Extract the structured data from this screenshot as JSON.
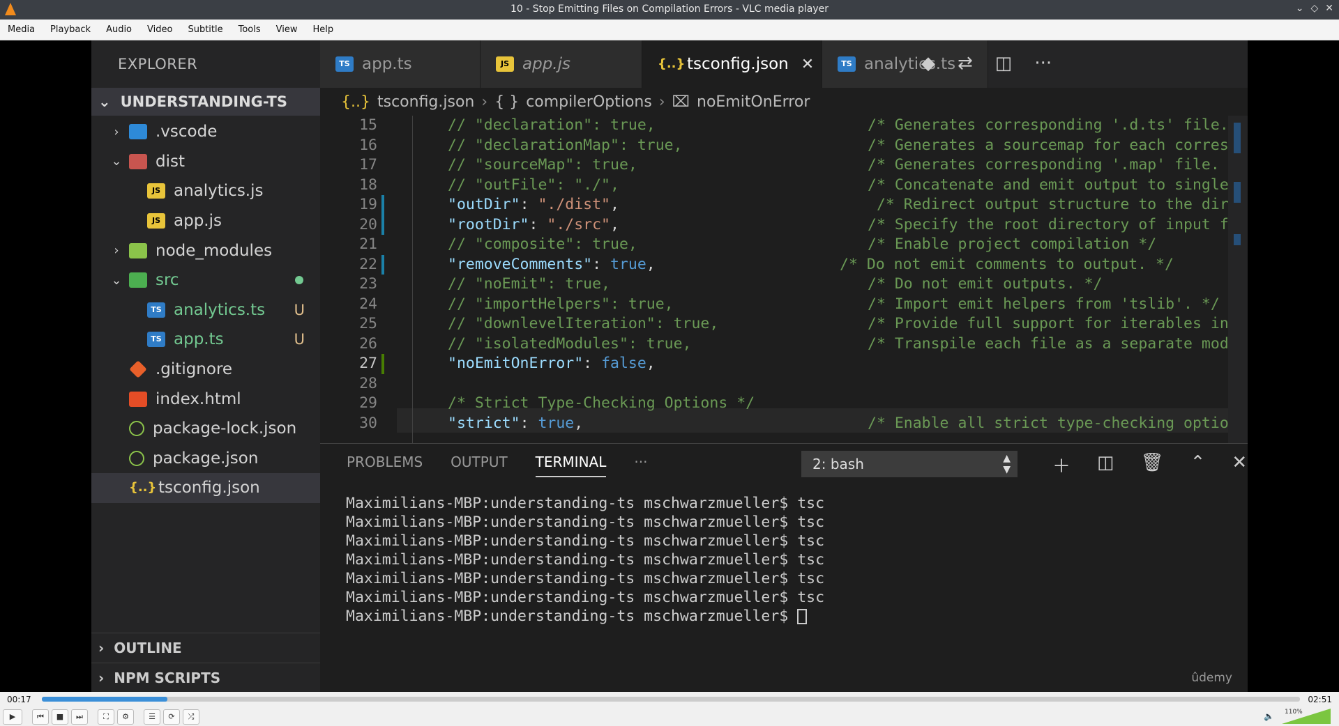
{
  "window": {
    "title": "10 - Stop Emitting Files on Compilation Errors - VLC media player"
  },
  "menu": [
    "Media",
    "Playback",
    "Audio",
    "Video",
    "Subtitle",
    "Tools",
    "View",
    "Help"
  ],
  "sidebar": {
    "header": "EXPLORER",
    "root": "UNDERSTANDING-TS",
    "items": [
      {
        "label": ".vscode",
        "icon": "vscode-folder-icon",
        "kind": "vsc",
        "indent": 1,
        "chev": "›",
        "badge": ""
      },
      {
        "label": "dist",
        "icon": "folder-icon",
        "kind": "fold",
        "indent": 1,
        "chev": "⌄",
        "badge": ""
      },
      {
        "label": "analytics.js",
        "icon": "js-file-icon",
        "kind": "js",
        "indent": 2,
        "chev": "",
        "badge": ""
      },
      {
        "label": "app.js",
        "icon": "js-file-icon",
        "kind": "js",
        "indent": 2,
        "chev": "",
        "badge": ""
      },
      {
        "label": "node_modules",
        "icon": "node-folder-icon",
        "kind": "node",
        "indent": 1,
        "chev": "›",
        "badge": ""
      },
      {
        "label": "src",
        "icon": "src-folder-icon",
        "kind": "src",
        "indent": 1,
        "chev": "⌄",
        "badge": "dot"
      },
      {
        "label": "analytics.ts",
        "icon": "ts-file-icon",
        "kind": "ts",
        "indent": 2,
        "chev": "",
        "badge": "U"
      },
      {
        "label": "app.ts",
        "icon": "ts-file-icon",
        "kind": "ts",
        "indent": 2,
        "chev": "",
        "badge": "U"
      },
      {
        "label": ".gitignore",
        "icon": "git-icon",
        "kind": "git",
        "indent": 1,
        "chev": "",
        "badge": ""
      },
      {
        "label": "index.html",
        "icon": "html-icon",
        "kind": "html",
        "indent": 1,
        "chev": "",
        "badge": ""
      },
      {
        "label": "package-lock.json",
        "icon": "npm-json-icon",
        "kind": "json",
        "indent": 1,
        "chev": "",
        "badge": ""
      },
      {
        "label": "package.json",
        "icon": "npm-json-icon",
        "kind": "json",
        "indent": 1,
        "chev": "",
        "badge": ""
      },
      {
        "label": "tsconfig.json",
        "icon": "json-braces-icon",
        "kind": "cfg",
        "indent": 1,
        "chev": "",
        "badge": "",
        "selected": true
      }
    ],
    "outline": "OUTLINE",
    "npm_scripts": "NPM SCRIPTS"
  },
  "tabs": [
    {
      "label": "app.ts",
      "kind": "ts"
    },
    {
      "label": "app.js",
      "kind": "js"
    },
    {
      "label": "tsconfig.json",
      "kind": "cfg",
      "active": true
    },
    {
      "label": "analytics.ts",
      "kind": "ts"
    }
  ],
  "breadcrumb": [
    "tsconfig.json",
    "compilerOptions",
    "noEmitOnError"
  ],
  "code": [
    {
      "n": "15",
      "text": "// \"declaration\": true,",
      "comment": "/* Generates corresponding '.d.ts' file.",
      "mark": ""
    },
    {
      "n": "16",
      "text": "// \"declarationMap\": true,",
      "comment": "/* Generates a sourcemap for each corres",
      "mark": ""
    },
    {
      "n": "17",
      "text": "// \"sourceMap\": true,",
      "comment": "/* Generates corresponding '.map' file.",
      "mark": ""
    },
    {
      "n": "18",
      "text": "// \"outFile\": \"./\",",
      "comment": "/* Concatenate and emit output to single",
      "mark": ""
    },
    {
      "n": "19",
      "key": "\"outDir\"",
      "val": "\"./dist\"",
      "valkind": "str",
      "comment": " /* Redirect output structure to the dir",
      "mark": "b"
    },
    {
      "n": "20",
      "key": "\"rootDir\"",
      "val": "\"./src\"",
      "valkind": "str",
      "comment": "/* Specify the root directory of input f",
      "mark": "b"
    },
    {
      "n": "21",
      "text": "// \"composite\": true,",
      "comment": "/* Enable project compilation */",
      "mark": ""
    },
    {
      "n": "22",
      "key": "\"removeComments\"",
      "val": "true",
      "valkind": "bool",
      "comment": "/* Do not emit comments to output. */",
      "mark": "b",
      "commentShift": true
    },
    {
      "n": "23",
      "text": "// \"noEmit\": true,",
      "comment": "/* Do not emit outputs. */",
      "mark": ""
    },
    {
      "n": "24",
      "text": "// \"importHelpers\": true,",
      "comment": "/* Import emit helpers from 'tslib'. */",
      "mark": ""
    },
    {
      "n": "25",
      "text": "// \"downlevelIteration\": true,",
      "comment": "/* Provide full support for iterables in",
      "mark": ""
    },
    {
      "n": "26",
      "text": "// \"isolatedModules\": true,",
      "comment": "/* Transpile each file as a separate mod",
      "mark": ""
    },
    {
      "n": "27",
      "key": "\"noEmitOnError\"",
      "val": "false",
      "valkind": "bool",
      "comment": "",
      "mark": "g"
    },
    {
      "n": "28",
      "text": "",
      "comment": "",
      "mark": ""
    },
    {
      "n": "29",
      "text": "/* Strict Type-Checking Options */",
      "comment": "",
      "mark": ""
    },
    {
      "n": "30",
      "key": "\"strict\"",
      "val": "true",
      "valkind": "bool",
      "comment": "/* Enable all strict type-checking optio",
      "mark": ""
    }
  ],
  "panel": {
    "tabs": [
      "PROBLEMS",
      "OUTPUT",
      "TERMINAL",
      "···"
    ],
    "active_tab": "TERMINAL",
    "shell_select": "2: bash",
    "terminal": [
      "Maximilians-MBP:understanding-ts mschwarzmueller$ tsc",
      "Maximilians-MBP:understanding-ts mschwarzmueller$ tsc",
      "Maximilians-MBP:understanding-ts mschwarzmueller$ tsc",
      "Maximilians-MBP:understanding-ts mschwarzmueller$ tsc",
      "Maximilians-MBP:understanding-ts mschwarzmueller$ tsc",
      "Maximilians-MBP:understanding-ts mschwarzmueller$ tsc",
      "Maximilians-MBP:understanding-ts mschwarzmueller$ "
    ],
    "watermark": "ûdemy"
  },
  "player": {
    "elapsed": "00:17",
    "total": "02:51",
    "progress": 0.1,
    "volume": "110%"
  },
  "colors": {
    "accent": "#3b8fd8",
    "vlc_orange": "#f28b1c",
    "volume_green": "#7bc640"
  }
}
